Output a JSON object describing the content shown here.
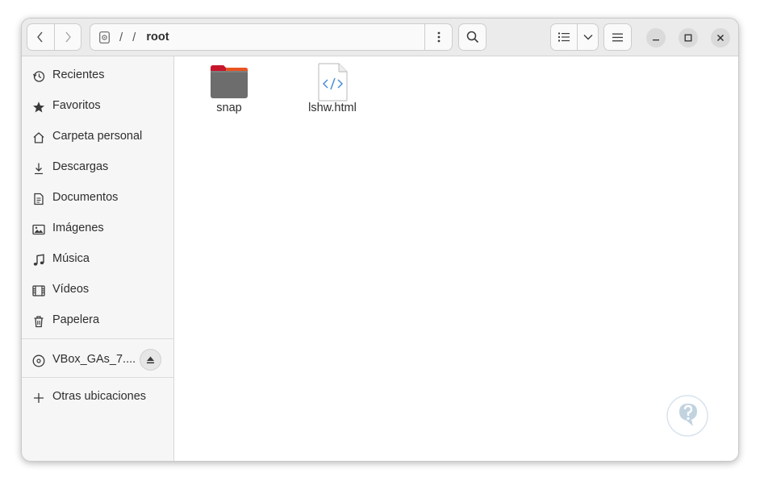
{
  "headerbar": {
    "path_segments": [
      "/",
      "/",
      "root"
    ],
    "current_folder": "root",
    "back_icon": "chevron-left-icon",
    "forward_icon": "chevron-right-icon",
    "more_icon": "vertical-dots-icon",
    "search_icon": "search-icon",
    "list_view_icon": "list-view-icon",
    "view_options_icon": "chevron-down-icon",
    "menu_icon": "hamburger-icon",
    "minimize_icon": "minimize-icon",
    "maximize_icon": "maximize-icon",
    "close_icon": "close-icon"
  },
  "sidebar": {
    "places": [
      {
        "label": "Recientes",
        "icon": "clock-icon"
      },
      {
        "label": "Favoritos",
        "icon": "star-icon"
      },
      {
        "label": "Carpeta personal",
        "icon": "home-icon"
      },
      {
        "label": "Descargas",
        "icon": "download-icon"
      },
      {
        "label": "Documentos",
        "icon": "document-icon"
      },
      {
        "label": "Imágenes",
        "icon": "image-icon"
      },
      {
        "label": "Música",
        "icon": "music-icon"
      },
      {
        "label": "Vídeos",
        "icon": "video-icon"
      },
      {
        "label": "Papelera",
        "icon": "trash-icon"
      }
    ],
    "devices": [
      {
        "label": "VBox_GAs_7....",
        "icon": "disc-icon",
        "action_icon": "eject-icon"
      }
    ],
    "other": {
      "label": "Otras ubicaciones",
      "icon": "plus-icon"
    }
  },
  "files": [
    {
      "name": "snap",
      "type": "folder",
      "icon": "folder-icon"
    },
    {
      "name": "lshw.html",
      "type": "html",
      "icon": "html-file-icon"
    }
  ],
  "colors": {
    "folder_tab": "#e95420",
    "folder_body": "#6d6d6d",
    "folder_accent": "#c7162b",
    "html_icon": "#4a90d9"
  }
}
